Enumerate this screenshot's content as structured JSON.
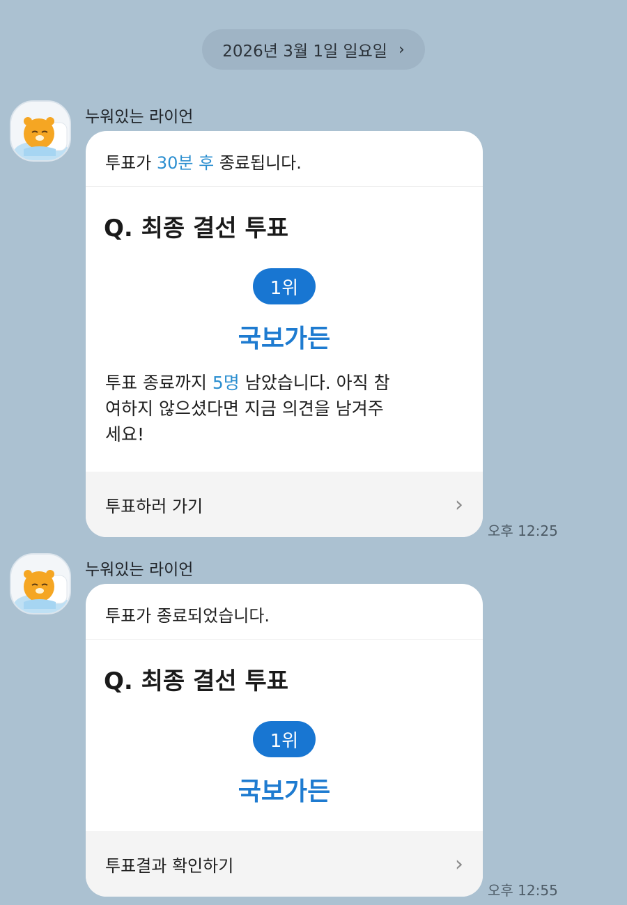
{
  "date_divider": {
    "label": "2026년 3월 1일 일요일",
    "chevron": "chevron-right-icon"
  },
  "messages": [
    {
      "sender": "누워있는 라이언",
      "notice_prefix": "투표가 ",
      "notice_highlight": "30분 후",
      "notice_suffix": " 종료됩니다.",
      "question": "Q. 최종 결선 투표",
      "rank": "1위",
      "winner": "국보가든",
      "remaining_prefix": "투표 종료까지 ",
      "remaining_highlight": "5명",
      "remaining_suffix": " 남았습니다. 아직 참여하지 않으셨다면 지금 의견을 남겨주세요!",
      "action_label": "투표하러 가기",
      "time": "오후 12:25"
    },
    {
      "sender": "누워있는 라이언",
      "notice": "투표가 종료되었습니다.",
      "question": "Q. 최종 결선 투표",
      "rank": "1위",
      "winner": "국보가든",
      "action_label": "투표결과 확인하기",
      "time": "오후 12:55"
    }
  ],
  "colors": {
    "background": "#abc1d1",
    "accent_text": "#2c8fd0",
    "rank_pill": "#1876d2",
    "winner_text": "#1e7bd0"
  }
}
